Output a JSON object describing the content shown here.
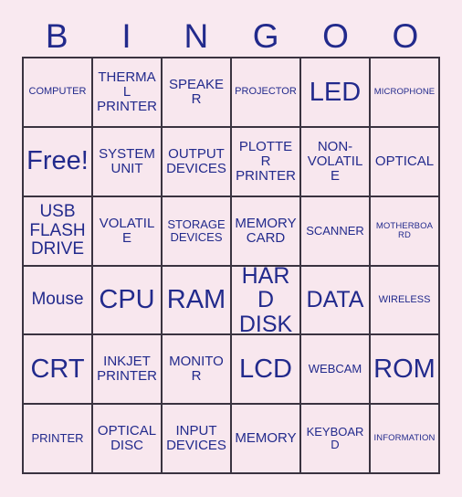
{
  "card": {
    "background_color": "#f9e9f0",
    "cell_background_color": "#f8e7ee",
    "text_color": "#222a8c",
    "border_color": "#3a3340",
    "columns": 6,
    "rows": 6
  },
  "header": {
    "letters": [
      "B",
      "I",
      "N",
      "G",
      "O",
      "O"
    ]
  },
  "grid": {
    "cells": [
      [
        {
          "label": "COMPUTER",
          "size": "xs"
        },
        {
          "label": "THERMAL PRINTER",
          "size": "m"
        },
        {
          "label": "SPEAKER",
          "size": "m"
        },
        {
          "label": "PROJECTOR",
          "size": "xs"
        },
        {
          "label": "LED",
          "size": "xxl"
        },
        {
          "label": "MICROPHONE",
          "size": "xxs"
        }
      ],
      [
        {
          "label": "Free!",
          "size": "xxl"
        },
        {
          "label": "SYSTEM UNIT",
          "size": "m"
        },
        {
          "label": "OUTPUT DEVICES",
          "size": "m"
        },
        {
          "label": "PLOTTER PRINTER",
          "size": "m"
        },
        {
          "label": "NON-VOLATILE",
          "size": "m"
        },
        {
          "label": "OPTICAL",
          "size": "m"
        }
      ],
      [
        {
          "label": "USB FLASH DRIVE",
          "size": "l"
        },
        {
          "label": "VOLATILE",
          "size": "m"
        },
        {
          "label": "STORAGE DEVICES",
          "size": "s"
        },
        {
          "label": "MEMORY CARD",
          "size": "m"
        },
        {
          "label": "SCANNER",
          "size": "s"
        },
        {
          "label": "MOTHERBOARD",
          "size": "xxs"
        }
      ],
      [
        {
          "label": "Mouse",
          "size": "l"
        },
        {
          "label": "CPU",
          "size": "xxl"
        },
        {
          "label": "RAM",
          "size": "xxl"
        },
        {
          "label": "HARD DISK",
          "size": "xl"
        },
        {
          "label": "DATA",
          "size": "xl"
        },
        {
          "label": "WIRELESS",
          "size": "xs"
        }
      ],
      [
        {
          "label": "CRT",
          "size": "xxl"
        },
        {
          "label": "INKJET PRINTER",
          "size": "m"
        },
        {
          "label": "MONITOR",
          "size": "m"
        },
        {
          "label": "LCD",
          "size": "xxl"
        },
        {
          "label": "WEBCAM",
          "size": "s"
        },
        {
          "label": "ROM",
          "size": "xxl"
        }
      ],
      [
        {
          "label": "PRINTER",
          "size": "s"
        },
        {
          "label": "OPTICAL DISC",
          "size": "m"
        },
        {
          "label": "INPUT DEVICES",
          "size": "m"
        },
        {
          "label": "MEMORY",
          "size": "m"
        },
        {
          "label": "KEYBOARD",
          "size": "s"
        },
        {
          "label": "INFORMATION",
          "size": "xxs"
        }
      ]
    ]
  }
}
